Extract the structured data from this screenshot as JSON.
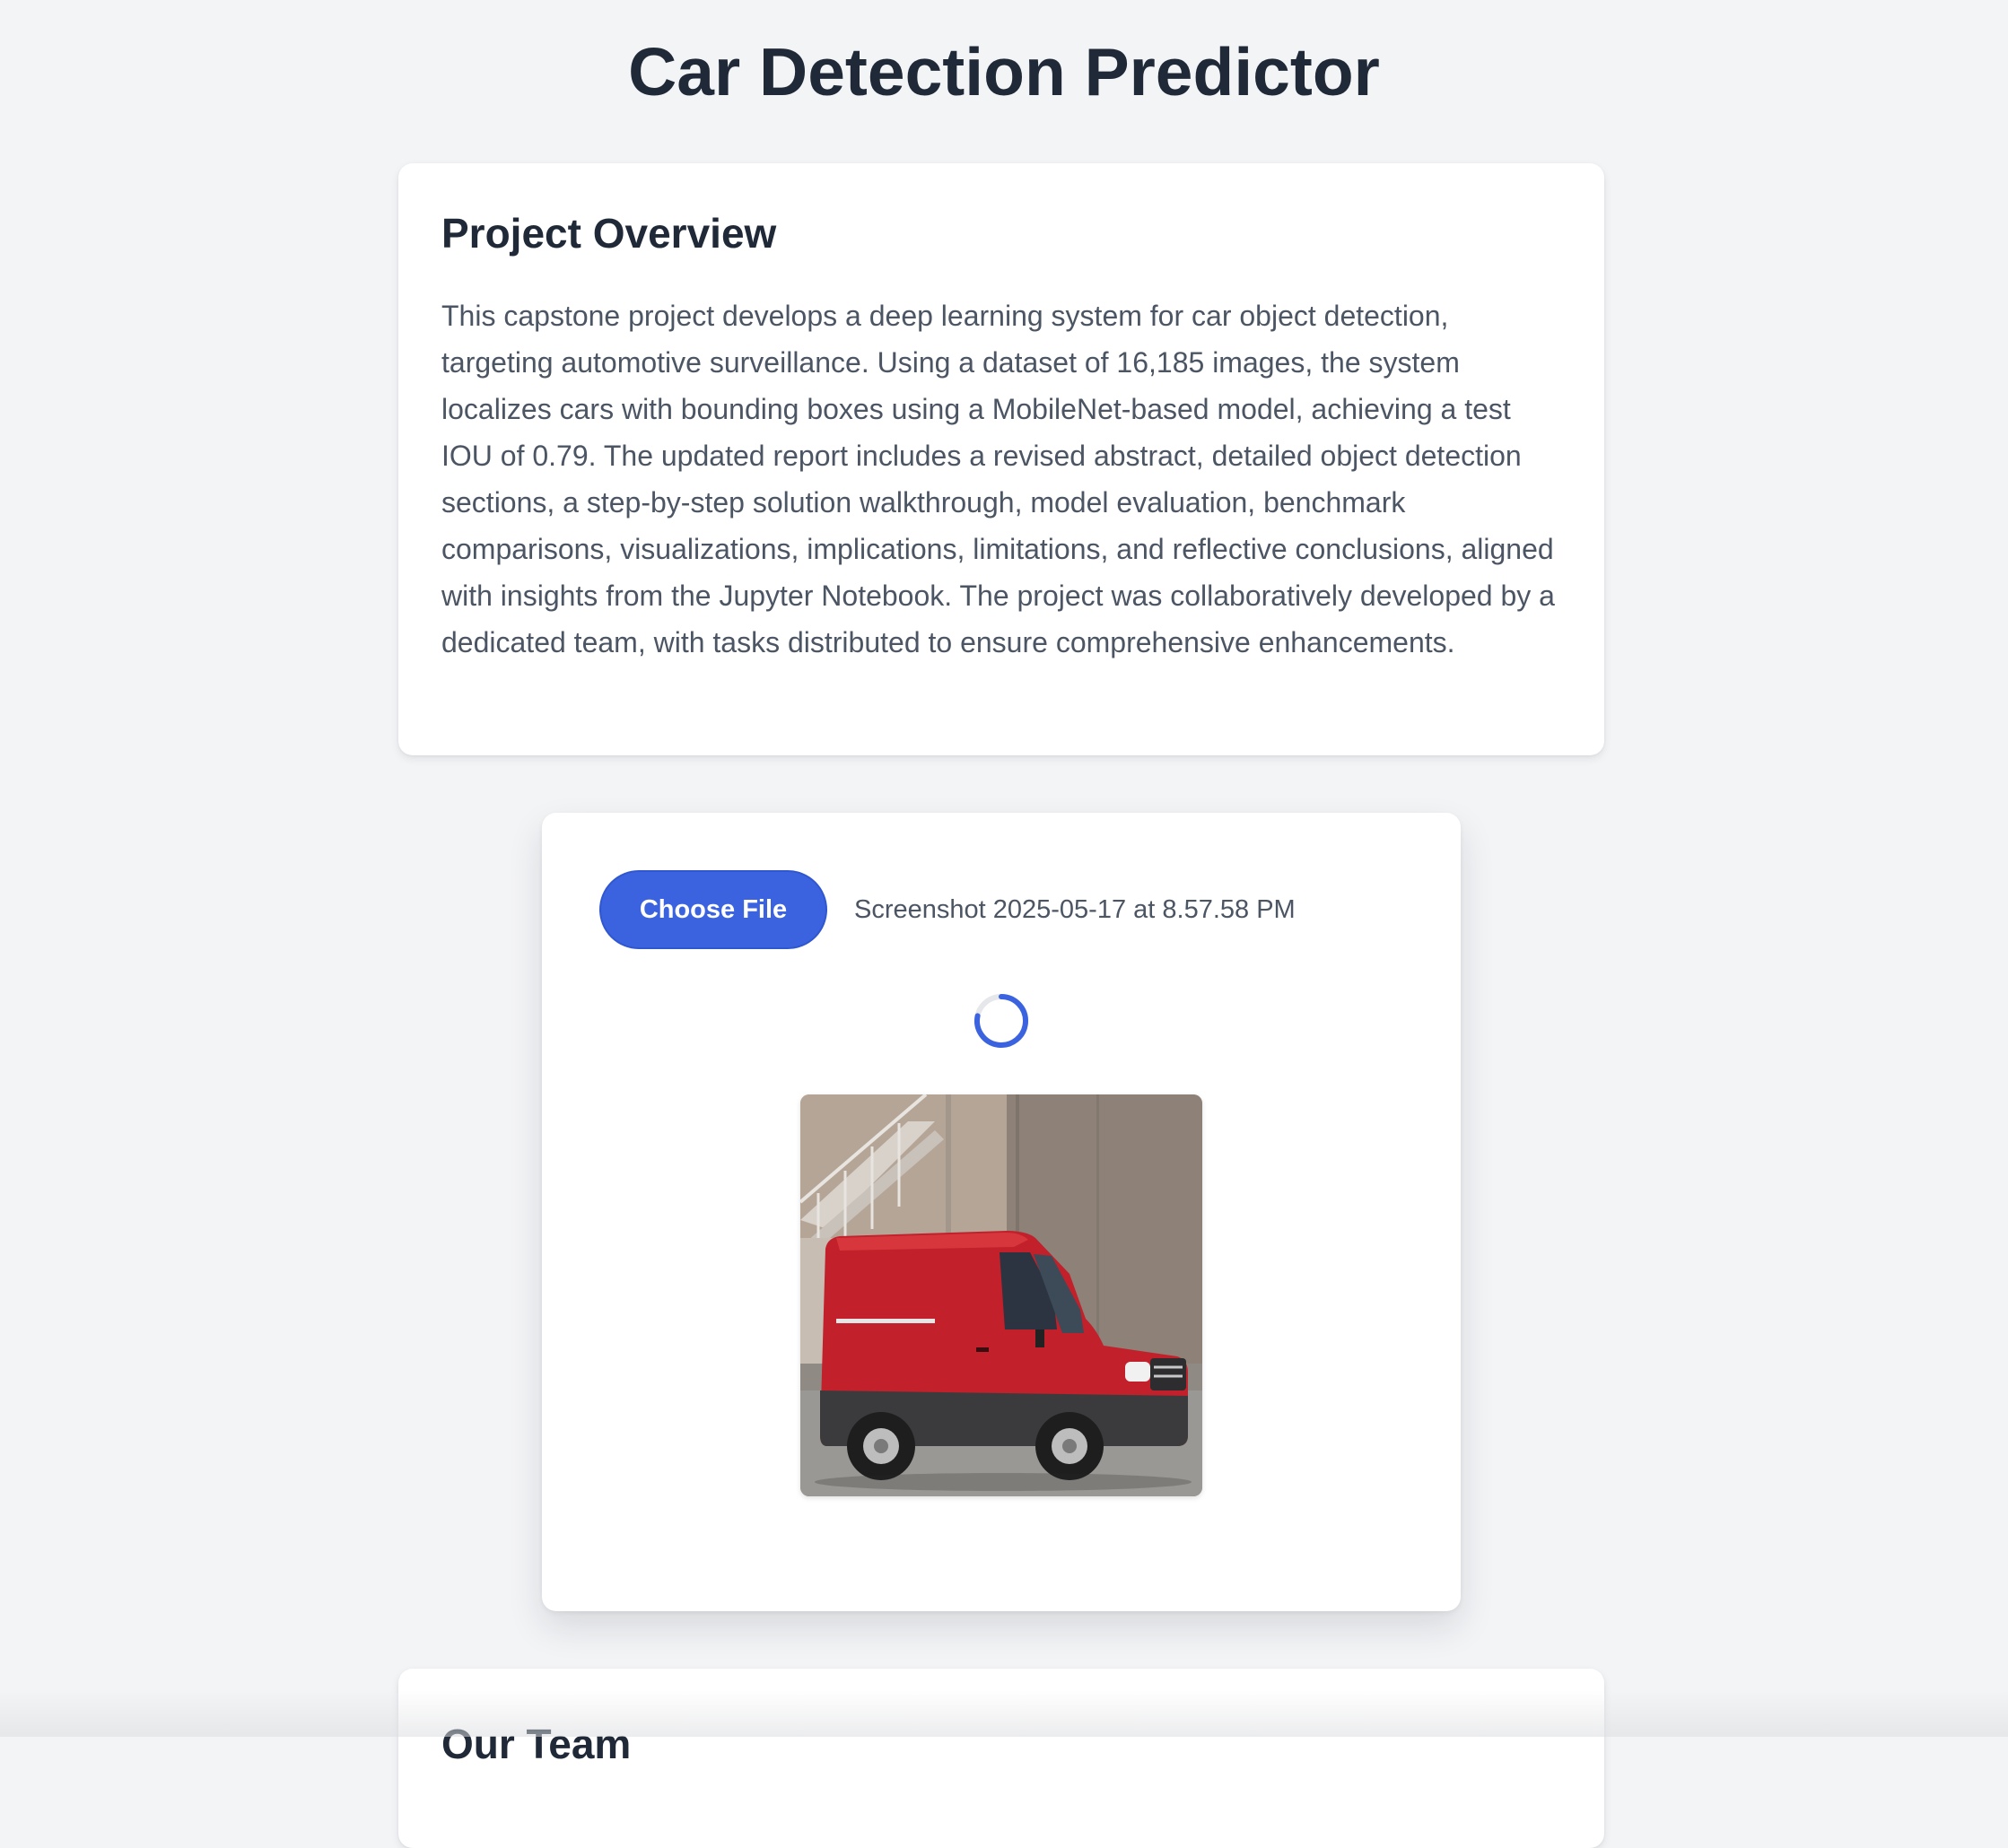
{
  "page": {
    "title": "Car Detection Predictor"
  },
  "overview": {
    "heading": "Project Overview",
    "text": "This capstone project develops a deep learning system for car object detection, targeting automotive surveillance. Using a dataset of 16,185 images, the system localizes cars with bounding boxes using a MobileNet-based model, achieving a test IOU of 0.79. The updated report includes a revised abstract, detailed object detection sections, a step-by-step solution walkthrough, model evaluation, benchmark comparisons, visualizations, implications, limitations, and reflective conclusions, aligned with insights from the Jupyter Notebook. The project was collaboratively developed by a dedicated team, with tasks distributed to ensure comprehensive enhancements."
  },
  "upload": {
    "button_label": "Choose File",
    "file_name": "Screenshot 2025-05-17 at 8.57.58 PM",
    "spinner_icon": "loading-spinner-icon",
    "preview_icon": "red-van-image"
  },
  "team": {
    "heading": "Our Team"
  },
  "colors": {
    "accent": "#3b63e0",
    "background": "#f3f4f6",
    "card": "#ffffff",
    "heading": "#1f2937",
    "body_text": "#4b5563"
  }
}
